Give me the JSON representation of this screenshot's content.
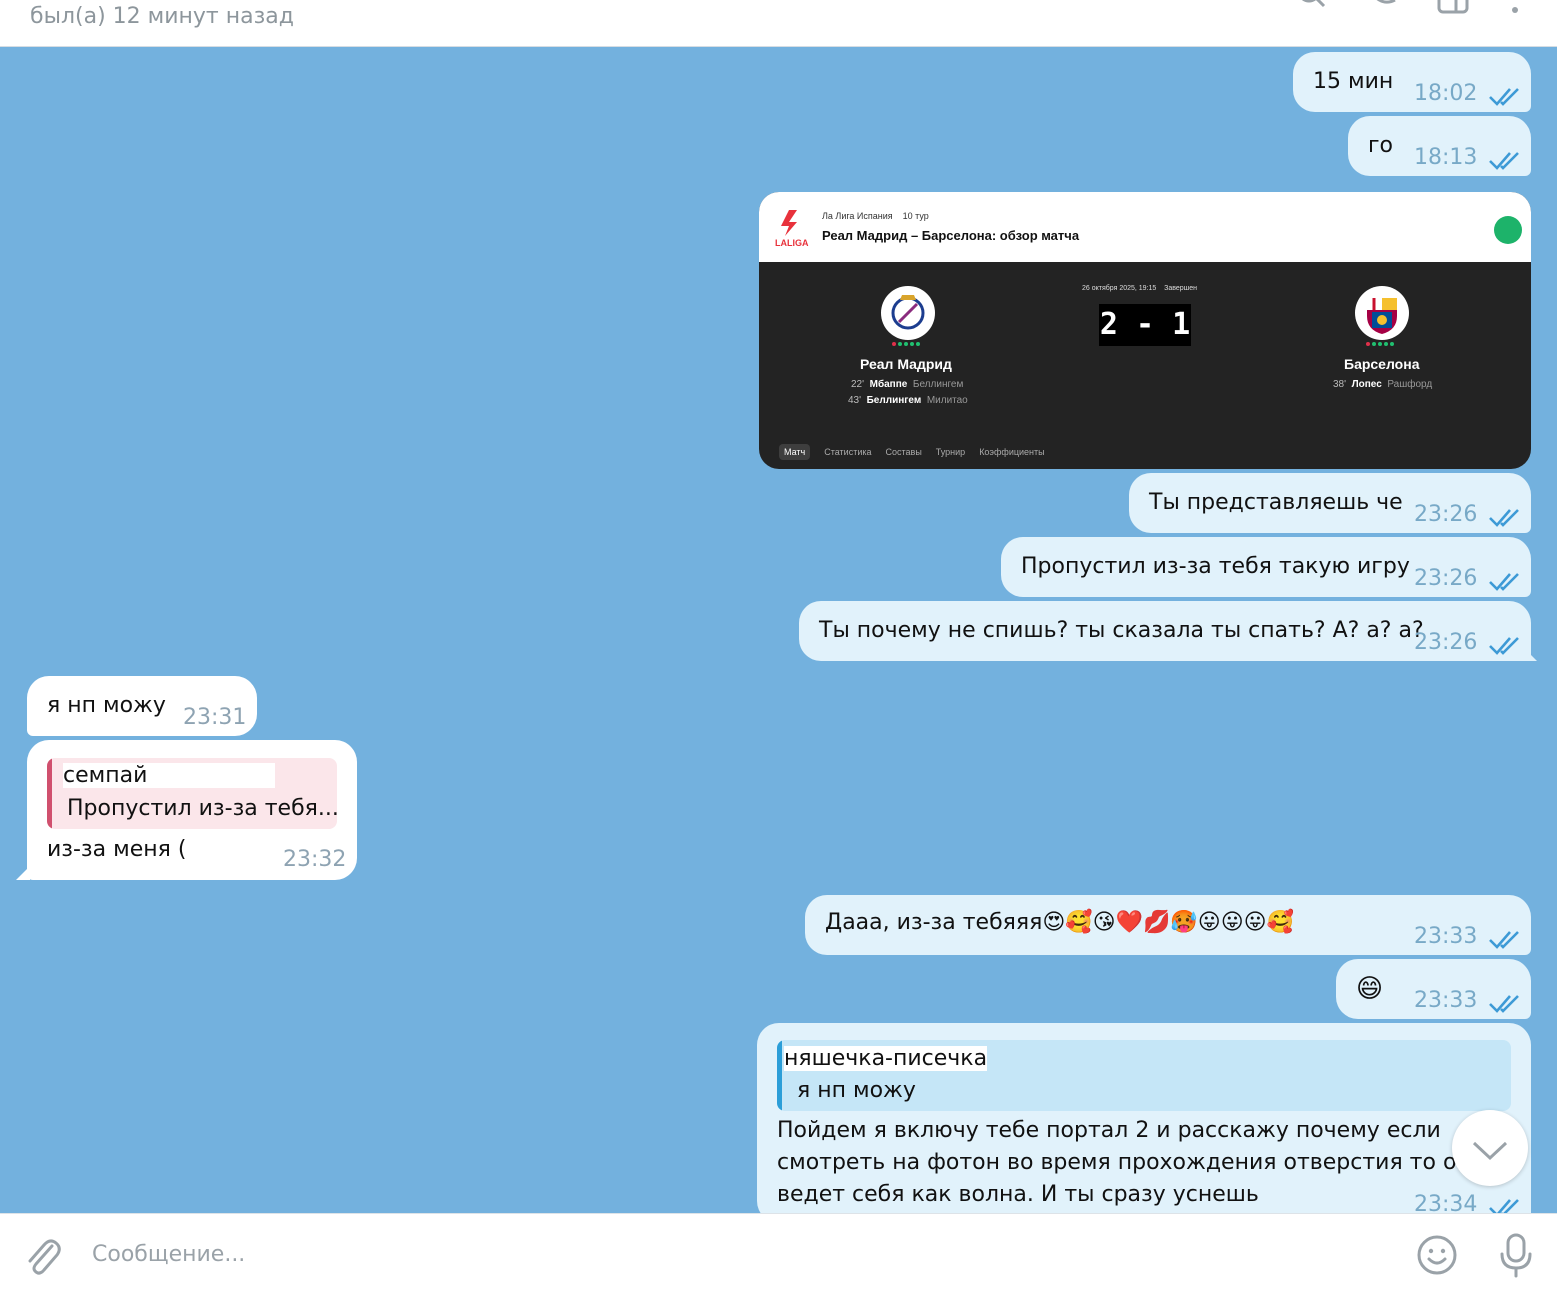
{
  "header": {
    "status": "был(а) 12 минут назад",
    "icons": [
      "search-icon",
      "phone-icon",
      "sidebar-icon",
      "more-icon"
    ]
  },
  "messages": [
    {
      "dir": "out",
      "text": "15 мин",
      "time": "18:02"
    },
    {
      "dir": "out",
      "text": "го",
      "time": "18:13"
    },
    {
      "dir": "out",
      "type": "match-card"
    },
    {
      "dir": "out",
      "text": "Ты представляешь че",
      "time": "23:26"
    },
    {
      "dir": "out",
      "text": "Пропустил из-за тебя такую игру",
      "time": "23:26"
    },
    {
      "dir": "out",
      "text": "Ты почему не спишь? ты сказала ты спать? А? а? а?",
      "time": "23:26"
    },
    {
      "dir": "in",
      "text": "я нп можу",
      "time": "23:31"
    },
    {
      "dir": "in",
      "reply": {
        "name": "семпай",
        "text": "Пропустил из-за тебя..."
      },
      "text": "из-за меня (",
      "time": "23:32"
    },
    {
      "dir": "out",
      "text": "Дааа, из-за тебяяя😍🥰😘❤️💋🥵😛😛😛🥰",
      "time": "23:33"
    },
    {
      "dir": "out",
      "text": "😄",
      "time": "23:33"
    },
    {
      "dir": "out",
      "reply": {
        "name": "няшечка-писечка",
        "text": "я нп можу"
      },
      "lines": [
        "Пойдем я включу тебе портал 2 и расскажу почему если",
        "смотреть на фотон во время прохождения отверстия то он",
        "ведет себя как волна. И ты сразу уснешь"
      ],
      "time": "23:34"
    }
  ],
  "match_card": {
    "league": "Ла Лига Испания",
    "round": "10 тур",
    "logo_text": "LALIGA",
    "title": "Реал Мадрид – Барселона: обзор матча",
    "date": "26 октября 2025, 19:15",
    "state": "Завершен",
    "score": "2 - 1",
    "home": {
      "name": "Реал Мадрид",
      "goals": [
        {
          "minute": "22'",
          "scorer": "Мбаппе",
          "assist": "Беллингем"
        },
        {
          "minute": "43'",
          "scorer": "Беллингем",
          "assist": "Милитао"
        }
      ]
    },
    "away": {
      "name": "Барселона",
      "goals": [
        {
          "minute": "38'",
          "scorer": "Лопес",
          "assist": "Рашфорд"
        }
      ]
    },
    "tabs": [
      "Матч",
      "Статистика",
      "Составы",
      "Турнир",
      "Коэффициенты"
    ]
  },
  "composer": {
    "placeholder": "Сообщение..."
  },
  "colors": {
    "chat_bg": "#73b1de",
    "outgoing_bubble": "#e1f2fb",
    "incoming_bubble": "#ffffff",
    "check_color": "#3d9ad6",
    "reply_in_bar": "#d0506e",
    "reply_out_bar": "#2b9ed8"
  }
}
